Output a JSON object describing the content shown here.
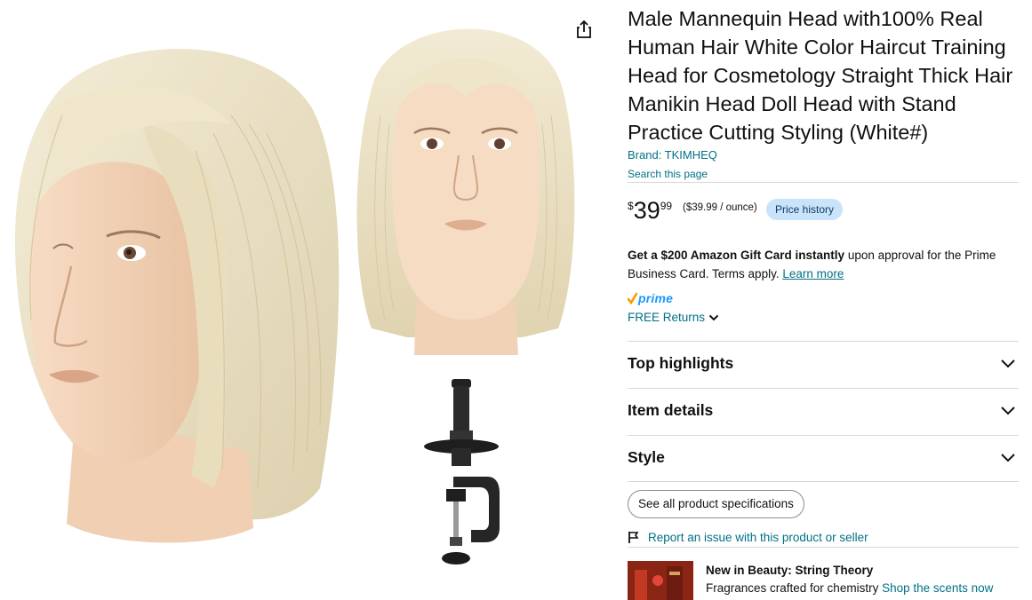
{
  "product": {
    "title": "Male Mannequin Head with100% Real Human Hair White Color Haircut Training Head for Cosmetology Straight Thick Hair Manikin Head Doll Head with Stand Practice Cutting Styling (White#)",
    "brand": "Brand: TKIMHEQ",
    "search_page": "Search this page"
  },
  "price": {
    "symbol": "$",
    "whole": "39",
    "fraction": "99",
    "unit_price": "($39.99 / ounce)",
    "history_label": "Price history"
  },
  "promo": {
    "bold": "Get a $200 Amazon Gift Card instantly",
    "rest": " upon approval for the Prime Business Card. Terms apply. ",
    "link": "Learn more"
  },
  "prime": {
    "label": "prime",
    "returns": "FREE Returns"
  },
  "accordions": [
    {
      "label": "Top highlights"
    },
    {
      "label": "Item details"
    },
    {
      "label": "Style"
    }
  ],
  "see_all_label": "See all product specifications",
  "report_label": "Report an issue with this product or seller",
  "ad": {
    "title": "New in Beauty: String Theory",
    "subtitle": "Fragrances crafted for chemistry ",
    "link": "Shop the scents now"
  },
  "icons": {
    "share": "share-icon",
    "flag": "flag-icon",
    "chevron": "chevron-down-icon",
    "prime_check": "prime-check-icon"
  },
  "colors": {
    "link": "#007185",
    "price_history_bg": "#c8e3fa",
    "prime_blue": "#1a98ff",
    "prime_check": "#ff9900",
    "divider": "#d5d9d9"
  }
}
